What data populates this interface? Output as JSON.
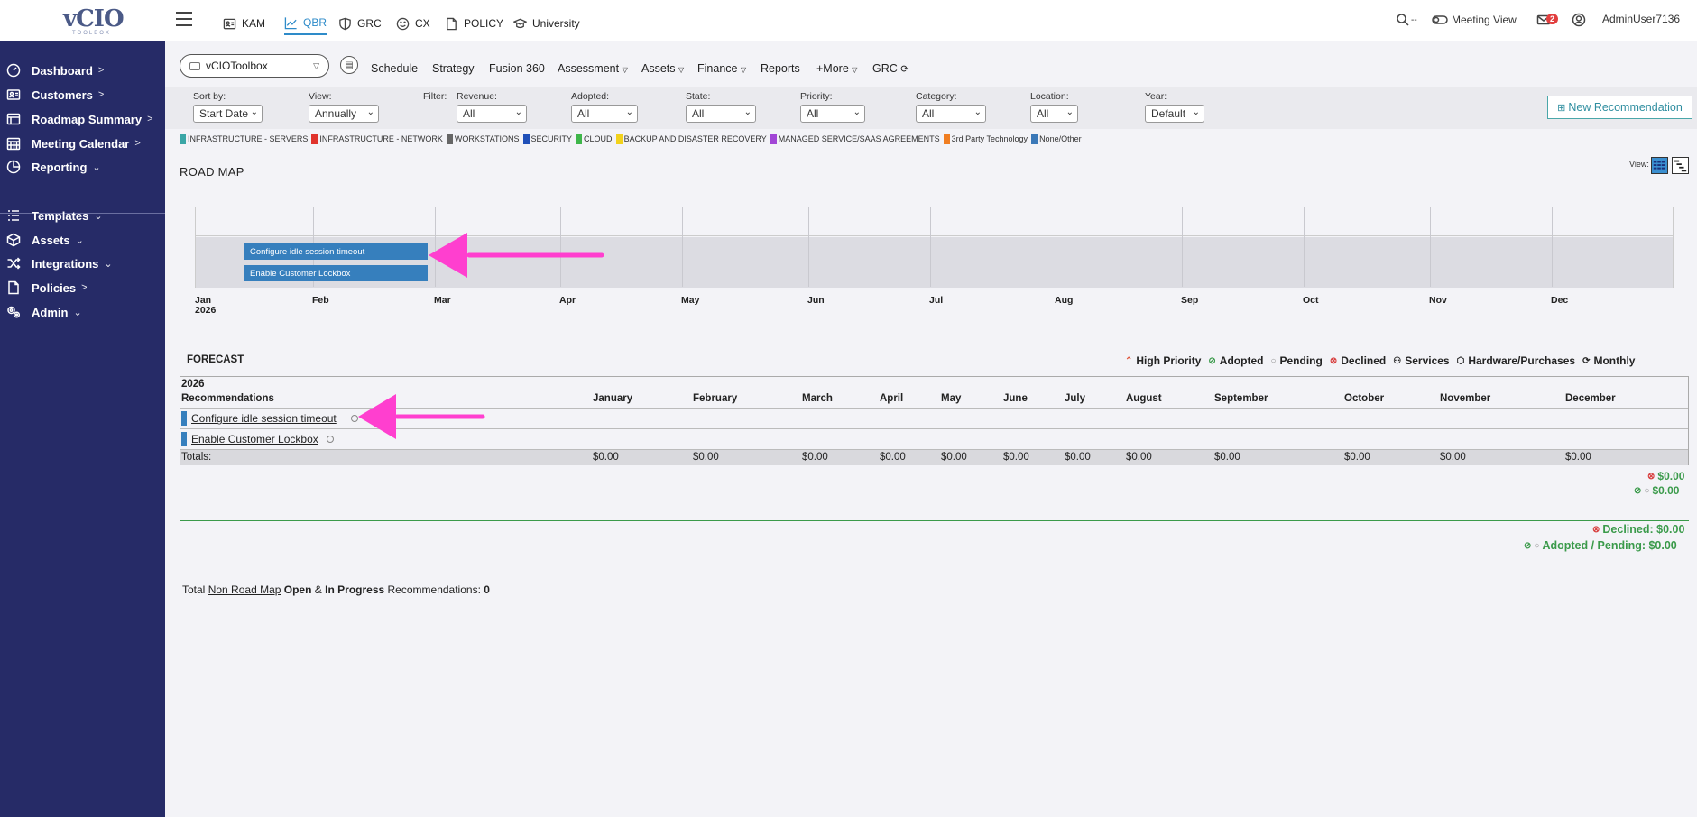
{
  "logo": {
    "text": "vCIO",
    "sub": "TOOLBOX"
  },
  "sidebar": {
    "items": [
      {
        "label": "Dashboard",
        "chev": ">"
      },
      {
        "label": "Customers",
        "chev": ">"
      },
      {
        "label": "Roadmap Summary",
        "chev": ">"
      },
      {
        "label": "Meeting Calendar",
        "chev": ">"
      },
      {
        "label": "Reporting",
        "chev": "⌄"
      },
      {
        "label": "Templates",
        "chev": "⌄"
      },
      {
        "label": "Assets",
        "chev": "⌄"
      },
      {
        "label": "Integrations",
        "chev": "⌄"
      },
      {
        "label": "Policies",
        "chev": ">"
      },
      {
        "label": "Admin",
        "chev": "⌄"
      }
    ]
  },
  "topbar": {
    "tabs": [
      "KAM",
      "QBR",
      "GRC",
      "CX",
      "POLICY",
      "University"
    ],
    "active_tab": "QBR",
    "meeting_view": "Meeting View",
    "mail_count": "2",
    "user": "AdminUser7136"
  },
  "subnav": {
    "company": "vCIOToolbox",
    "links": [
      "Schedule",
      "Strategy",
      "Fusion 360",
      "Assessment",
      "Assets",
      "Finance",
      "Reports",
      "+More",
      "GRC"
    ]
  },
  "filters": {
    "sort_by": {
      "label": "Sort by:",
      "value": "Start Date"
    },
    "view": {
      "label": "View:",
      "value": "Annually"
    },
    "filter_label": "Filter:",
    "revenue": {
      "label": "Revenue:",
      "value": "All"
    },
    "adopted": {
      "label": "Adopted:",
      "value": "All"
    },
    "state": {
      "label": "State:",
      "value": "All"
    },
    "priority": {
      "label": "Priority:",
      "value": "All"
    },
    "category": {
      "label": "Category:",
      "value": "All"
    },
    "location": {
      "label": "Location:",
      "value": "All"
    },
    "year": {
      "label": "Year:",
      "value": "Default"
    },
    "new_button": "New Recommendation"
  },
  "legend": [
    {
      "label": "INFRASTRUCTURE - SERVERS",
      "color": "#3aa6a6"
    },
    {
      "label": "INFRASTRUCTURE - NETWORK",
      "color": "#e0332c"
    },
    {
      "label": "WORKSTATIONS",
      "color": "#666666"
    },
    {
      "label": "SECURITY",
      "color": "#1f4fb8"
    },
    {
      "label": "CLOUD",
      "color": "#3fb64a"
    },
    {
      "label": "BACKUP AND DISASTER RECOVERY",
      "color": "#f2d21c"
    },
    {
      "label": "MANAGED SERVICE/SAAS AGREEMENTS",
      "color": "#a246d6"
    },
    {
      "label": "3rd Party Technology",
      "color": "#f07e22"
    },
    {
      "label": "None/Other",
      "color": "#3b79b8"
    }
  ],
  "roadmap": {
    "title": "ROAD MAP",
    "view_label": "View:",
    "months": [
      "Jan",
      "Feb",
      "Mar",
      "Apr",
      "May",
      "Jun",
      "Jul",
      "Aug",
      "Sep",
      "Oct",
      "Nov",
      "Dec"
    ],
    "year": "2026",
    "bars": [
      "Configure idle session timeout",
      "Enable Customer Lockbox"
    ]
  },
  "forecast": {
    "title": "FORECAST",
    "status_legend": [
      "High Priority",
      "Adopted",
      "Pending",
      "Declined",
      "Services",
      "Hardware/Purchases",
      "Monthly"
    ],
    "year": "2026",
    "col_rec": "Recommendations",
    "months": [
      "January",
      "February",
      "March",
      "April",
      "May",
      "June",
      "July",
      "August",
      "September",
      "October",
      "November",
      "December"
    ],
    "rows": [
      "Configure idle session timeout",
      "Enable Customer Lockbox"
    ],
    "totals_label": "Totals:",
    "totals": [
      "$0.00",
      "$0.00",
      "$0.00",
      "$0.00",
      "$0.00",
      "$0.00",
      "$0.00",
      "$0.00",
      "$0.00",
      "$0.00",
      "$0.00",
      "$0.00"
    ],
    "sum_declined_small": "$0.00",
    "sum_adopted_small": "$0.00",
    "declined": "Declined: $0.00",
    "adopted_pending": "Adopted / Pending: $0.00"
  },
  "nonroadmap": {
    "pre": "Total",
    "link": "Non Road Map",
    "open": "Open",
    "amp": "&",
    "inprog": "In Progress",
    "post": "Recommendations:",
    "count": "0"
  }
}
